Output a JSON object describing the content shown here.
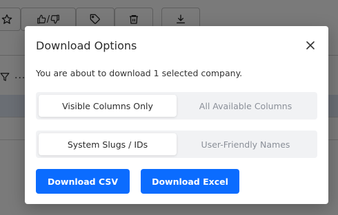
{
  "modal": {
    "title": "Download Options",
    "description": "You are about to download 1 selected company.",
    "columns_scope": {
      "options": [
        "Visible Columns Only",
        "All Available Columns"
      ],
      "selected": "Visible Columns Only"
    },
    "naming": {
      "options": [
        "System Slugs / IDs",
        "User-Friendly Names"
      ],
      "selected": "System Slugs / IDs"
    },
    "buttons": {
      "csv": "Download CSV",
      "excel": "Download Excel"
    },
    "accent_color": "#0b6cff"
  },
  "background": {
    "toolbar_icons": [
      "star-icon",
      "thumbs-up-down-icon",
      "tag-icon",
      "trash-icon",
      "download-icon"
    ],
    "thumbs_separator": "/",
    "more_label": "..."
  }
}
